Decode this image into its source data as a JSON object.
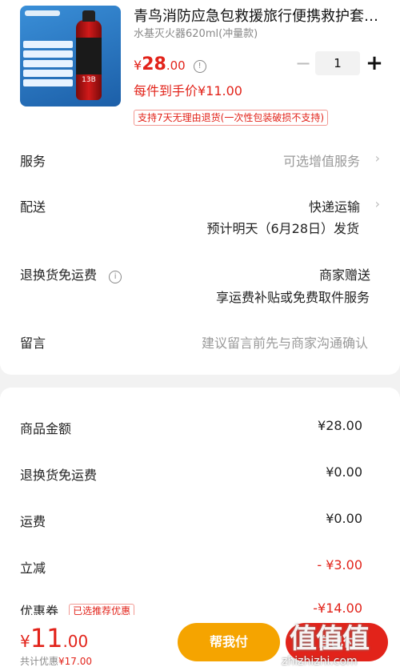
{
  "product": {
    "title": "青鸟消防应急包救援旅行便携救护套…",
    "spec": "水基灭火器620ml(冲量款)",
    "price_symbol": "¥",
    "price_int": "28",
    "price_dec": ".00",
    "quantity": "1",
    "per_piece_price": "每件到手价¥11.00",
    "return_tag": "支持7天无理由退货(一次性包装破损不支持)",
    "image_label": "13B"
  },
  "options": {
    "service": {
      "label": "服务",
      "value": "可选增值服务"
    },
    "delivery": {
      "label": "配送",
      "value": "快递运输",
      "sub": "预计明天（6月28日）发货"
    },
    "return_shipping": {
      "label": "退换货免运费",
      "value": "商家赠送",
      "sub": "享运费补贴或免费取件服务"
    },
    "message": {
      "label": "留言",
      "placeholder": "建议留言前先与商家沟通确认"
    }
  },
  "summary": {
    "goods_amount": {
      "label": "商品金额",
      "value": "¥28.00"
    },
    "return_fee": {
      "label": "退换货免运费",
      "value": "¥0.00"
    },
    "shipping": {
      "label": "运费",
      "value": "¥0.00"
    },
    "discount": {
      "label": "立减",
      "value": "- ¥3.00"
    },
    "coupon": {
      "label": "优惠券",
      "tag": "已选推荐优惠",
      "value": "-¥14.00"
    }
  },
  "bottom": {
    "total_symbol": "¥",
    "total_int": "11",
    "total_dec": ".00",
    "saved_label": "共计优惠",
    "saved_value": "¥17.00",
    "help_pay_label": "帮我付",
    "self_pay_label": "自己付"
  },
  "watermark": {
    "mark": "值值值",
    "text": "zhizhizhi.com"
  },
  "colors": {
    "accent_red": "#e2231a",
    "orange": "#f5a400"
  }
}
